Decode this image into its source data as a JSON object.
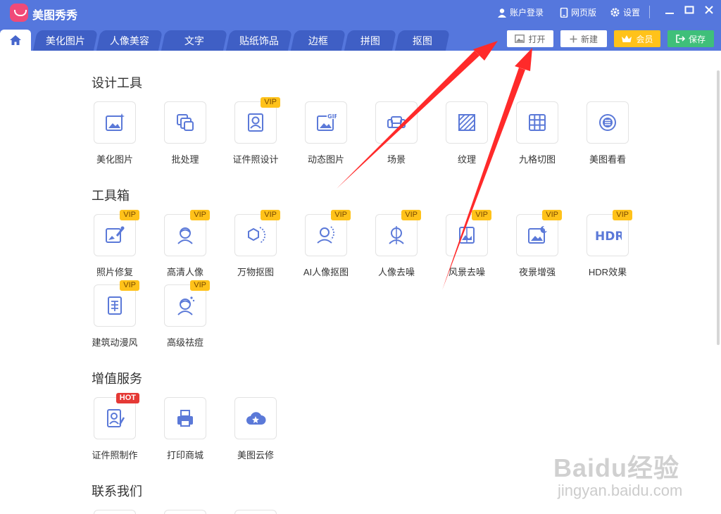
{
  "app": {
    "title": "美图秀秀"
  },
  "topbar": {
    "login_label": "账户登录",
    "web_label": "网页版",
    "settings_label": "设置"
  },
  "tabs": [
    "美化图片",
    "人像美容",
    "文字",
    "贴纸饰品",
    "边框",
    "拼图",
    "抠图"
  ],
  "actions": {
    "open_label": "打开",
    "new_label": "新建",
    "vip_label": "会员",
    "save_label": "保存"
  },
  "sections": {
    "design": {
      "title": "设计工具",
      "items": [
        {
          "label": "美化图片",
          "icon": "picture-sparkle-icon",
          "badge": ""
        },
        {
          "label": "批处理",
          "icon": "batch-icon",
          "badge": ""
        },
        {
          "label": "证件照设计",
          "icon": "id-photo-icon",
          "badge": "VIP"
        },
        {
          "label": "动态图片",
          "icon": "gif-icon",
          "badge": ""
        },
        {
          "label": "场景",
          "icon": "sofa-icon",
          "badge": ""
        },
        {
          "label": "纹理",
          "icon": "texture-icon",
          "badge": ""
        },
        {
          "label": "九格切图",
          "icon": "grid-icon",
          "badge": ""
        },
        {
          "label": "美图看看",
          "icon": "viewer-icon",
          "badge": ""
        }
      ]
    },
    "toolbox": {
      "title": "工具箱",
      "items": [
        {
          "label": "照片修复",
          "icon": "photo-repair-icon",
          "badge": "VIP"
        },
        {
          "label": "高清人像",
          "icon": "portrait-icon",
          "badge": "VIP"
        },
        {
          "label": "万物抠图",
          "icon": "hexagon-cutout-icon",
          "badge": "VIP"
        },
        {
          "label": "AI人像抠图",
          "icon": "person-cutout-icon",
          "badge": "VIP"
        },
        {
          "label": "人像去噪",
          "icon": "portrait-denoise-icon",
          "badge": "VIP"
        },
        {
          "label": "风景去噪",
          "icon": "landscape-denoise-icon",
          "badge": "VIP"
        },
        {
          "label": "夜景增强",
          "icon": "night-scene-icon",
          "badge": "VIP"
        },
        {
          "label": "HDR效果",
          "icon": "hdr-icon",
          "badge": "VIP"
        },
        {
          "label": "建筑动漫风",
          "icon": "comic-icon",
          "badge": "VIP"
        },
        {
          "label": "高级祛痘",
          "icon": "acne-removal-icon",
          "badge": "VIP"
        }
      ]
    },
    "services": {
      "title": "增值服务",
      "items": [
        {
          "label": "证件照制作",
          "icon": "id-photo-make-icon",
          "badge": "HOT"
        },
        {
          "label": "打印商城",
          "icon": "printer-icon",
          "badge": ""
        },
        {
          "label": "美图云修",
          "icon": "cloud-star-icon",
          "badge": ""
        }
      ]
    },
    "contact": {
      "title": "联系我们"
    }
  },
  "watermark": {
    "brand": "Baidu经验",
    "site": "jingyan.baidu.com"
  },
  "colors": {
    "titlebar": "#5577dd",
    "tab": "#3f5fc5",
    "icon": "#5b79d8",
    "vip": "#ffc21a",
    "hot": "#e53935",
    "save": "#3fbf7a",
    "arrow": "#ff2a2a"
  }
}
